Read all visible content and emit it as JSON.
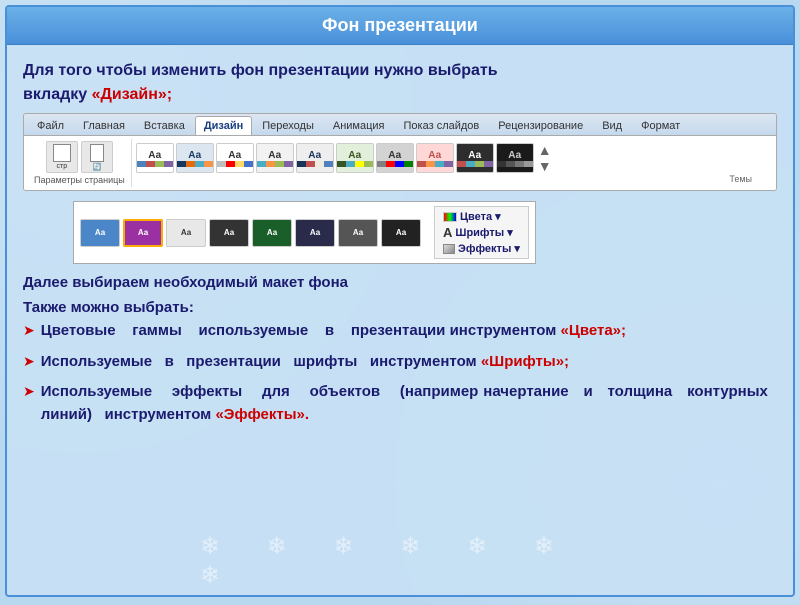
{
  "title": "Фон презентации",
  "intro": {
    "line1": "Для того чтобы изменить фон презентации нужно выбрать",
    "line2": "вкладку «Дизайн»;"
  },
  "ribbon": {
    "tabs": [
      "Файл",
      "Главная",
      "Вставка",
      "Дизайн",
      "Переходы",
      "Анимация",
      "Показ слайдов",
      "Рецензирование",
      "Вид",
      "Формат"
    ],
    "active_tab": "Дизайн",
    "group1_label": "Параметры страницы",
    "group1_icons": [
      "Параметры страницы",
      "Ориентация слайда"
    ],
    "themes_label": "Темы"
  },
  "sections": [
    {
      "text": "Далее выбираем необходимый макет фона"
    },
    {
      "text": "Также можно выбрать:"
    }
  ],
  "list_items": [
    {
      "text": "Цветовые    гаммы   используемые   в   презентации инструментом «Цвета»;"
    },
    {
      "text": "Используемые   в   презентации   шрифты   инструментом «Шрифты»;"
    },
    {
      "text": "Используемые   эффекты   для   объектов   (например начертание  и  толщина  контурных  линий)  инструментом «Эффекты»."
    }
  ],
  "theme_popup_options": [
    "✓ Цвета▾",
    "A Шрифты▾",
    "☐ Эффекты▾"
  ]
}
